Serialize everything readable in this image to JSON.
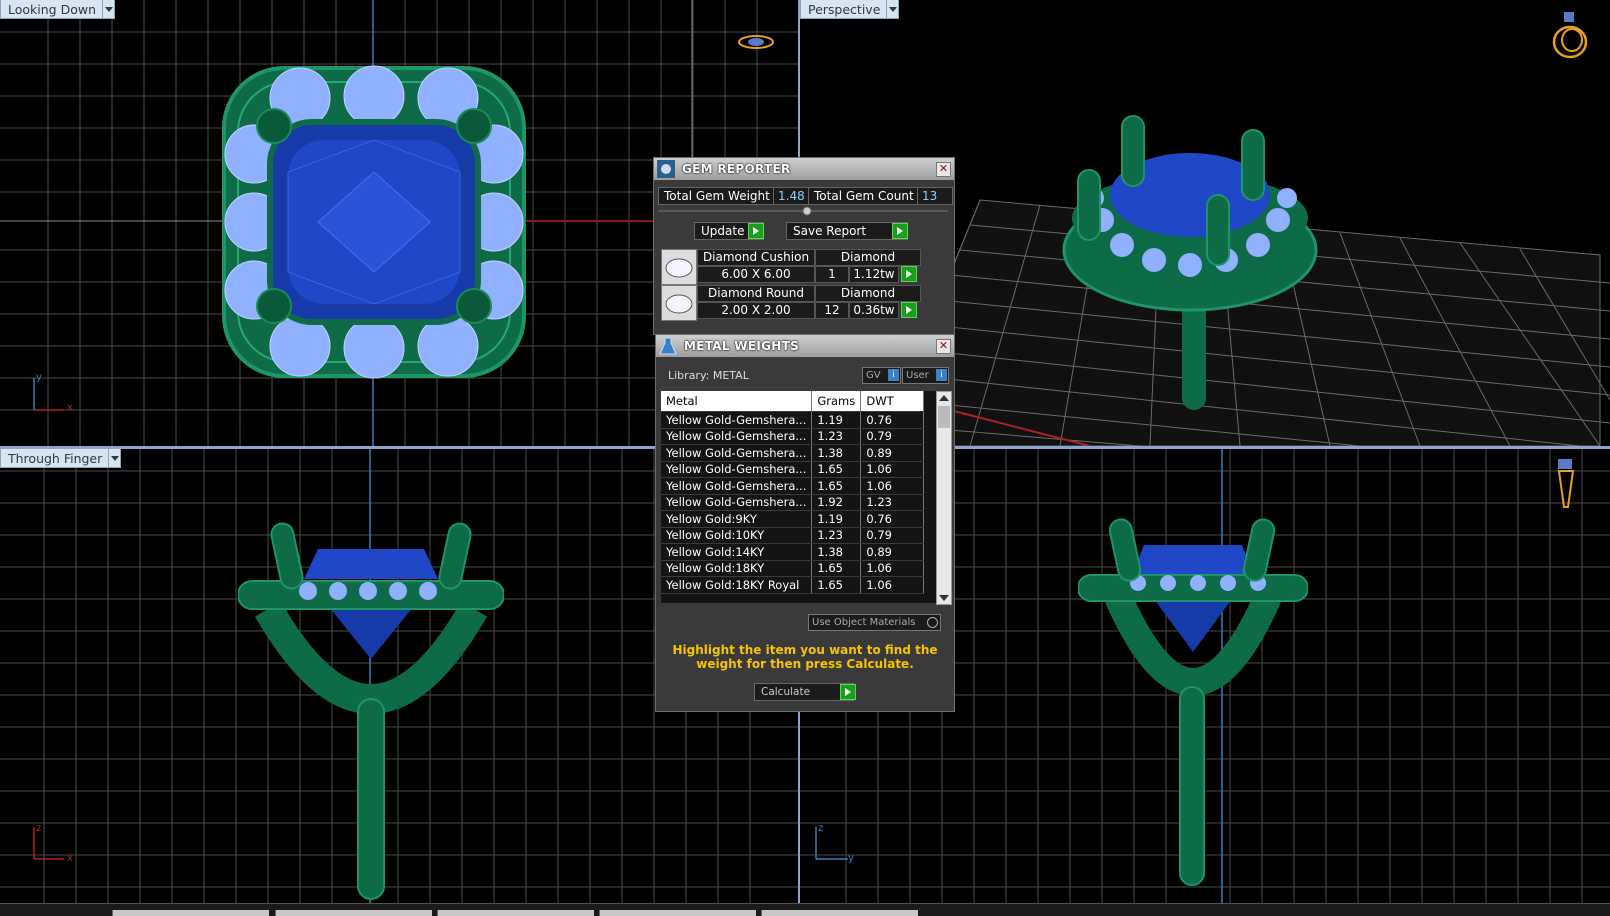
{
  "viewports": {
    "top_left": {
      "label": "Looking Down",
      "axis_a": "y",
      "axis_b": "x"
    },
    "top_right": {
      "label": "Perspective"
    },
    "bottom_left": {
      "label": "Through Finger",
      "axis_a": "z",
      "axis_b": "x"
    },
    "bottom_right": {
      "axis_a": "z",
      "axis_b": "y"
    }
  },
  "gem_reporter": {
    "title": "GEM REPORTER",
    "total_weight_label": "Total Gem Weight",
    "total_weight_value": "1.48",
    "total_count_label": "Total Gem Count",
    "total_count_value": "13",
    "update_label": "Update",
    "save_report_label": "Save Report",
    "gems": [
      {
        "name": "Diamond Cushion",
        "type": "Diamond",
        "size": "6.00 X 6.00",
        "count": "1",
        "weight": "1.12tw"
      },
      {
        "name": "Diamond Round",
        "type": "Diamond",
        "size": "2.00 X 2.00",
        "count": "12",
        "weight": "0.36tw"
      }
    ]
  },
  "metal_weights": {
    "title": "METAL WEIGHTS",
    "library_label": "Library: METAL",
    "gv_label": "GV",
    "user_label": "User",
    "columns": [
      "Metal",
      "Grams",
      "DWT"
    ],
    "rows": [
      [
        "Yellow Gold-Gemshera...",
        "1.19",
        "0.76"
      ],
      [
        "Yellow Gold-Gemshera...",
        "1.23",
        "0.79"
      ],
      [
        "Yellow Gold-Gemshera...",
        "1.38",
        "0.89"
      ],
      [
        "Yellow Gold-Gemshera...",
        "1.65",
        "1.06"
      ],
      [
        "Yellow Gold-Gemshera...",
        "1.65",
        "1.06"
      ],
      [
        "Yellow Gold-Gemshera...",
        "1.92",
        "1.23"
      ],
      [
        "Yellow Gold:9KY",
        "1.19",
        "0.76"
      ],
      [
        "Yellow Gold:10KY",
        "1.23",
        "0.79"
      ],
      [
        "Yellow Gold:14KY",
        "1.38",
        "0.89"
      ],
      [
        "Yellow Gold:18KY",
        "1.65",
        "1.06"
      ],
      [
        "Yellow Gold:18KY Royal",
        "1.65",
        "1.06"
      ]
    ],
    "use_object_materials_label": "Use Object Materials",
    "instruction": "Highlight the item you want to find the weight for then press Calculate.",
    "calculate_label": "Calculate"
  },
  "colors": {
    "metal_green": "#0e6b47",
    "gem_center": "#1f47c8",
    "gem_accent": "#8fb1ff",
    "grid_line": "#5a5a5a",
    "axis_line": "#3a7fb0",
    "value_text": "#7fd4ff",
    "instruction_text": "#f8c400"
  }
}
